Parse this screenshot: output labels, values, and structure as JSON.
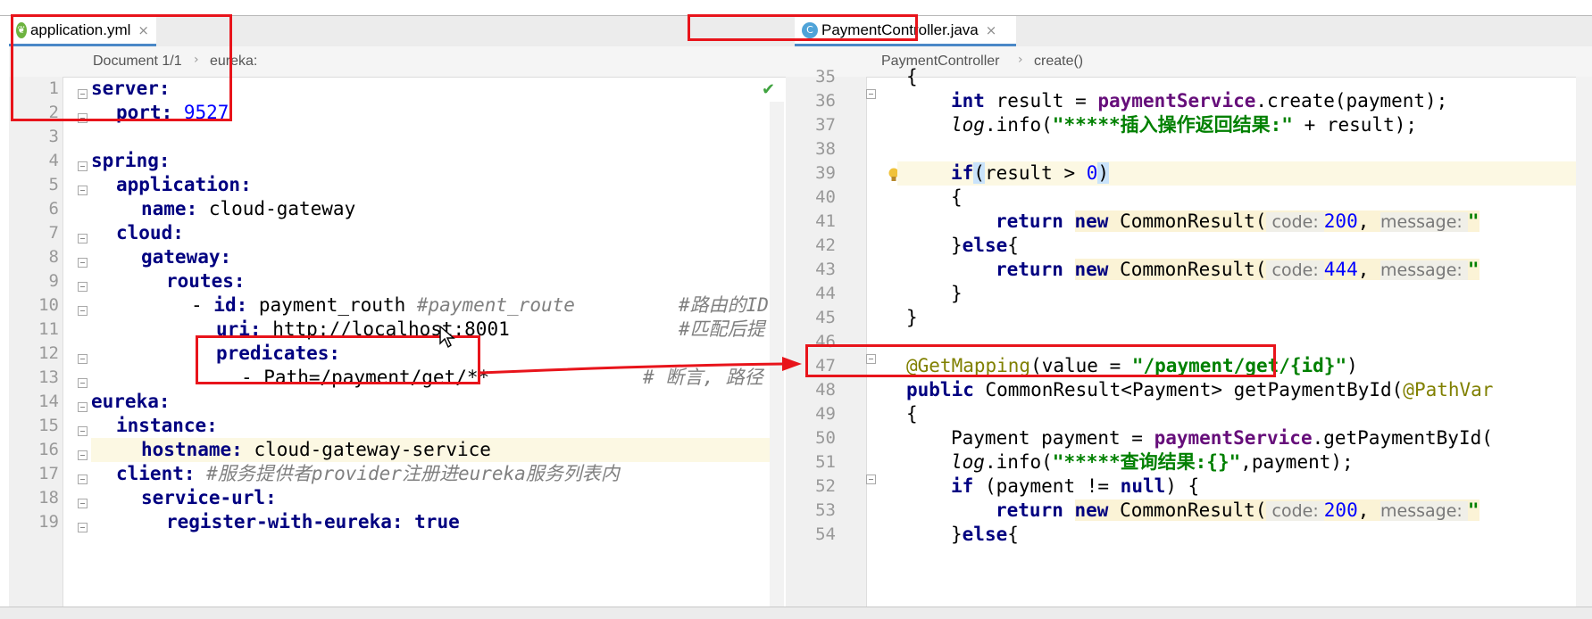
{
  "left_editor": {
    "tab": {
      "label": "application.yml",
      "close": "×"
    },
    "breadcrumb": [
      "Document 1/1",
      "eureka:"
    ],
    "crumb_sep": "›",
    "lines": [
      {
        "n": "1"
      },
      {
        "n": "2"
      },
      {
        "n": "3"
      },
      {
        "n": "4"
      },
      {
        "n": "5"
      },
      {
        "n": "6"
      },
      {
        "n": "7"
      },
      {
        "n": "8"
      },
      {
        "n": "9"
      },
      {
        "n": "10"
      },
      {
        "n": "11"
      },
      {
        "n": "12"
      },
      {
        "n": "13"
      },
      {
        "n": "14"
      },
      {
        "n": "15"
      },
      {
        "n": "16"
      },
      {
        "n": "17"
      },
      {
        "n": "18"
      },
      {
        "n": "19"
      }
    ],
    "code": {
      "l1_key": "server:",
      "l2_key": "port:",
      "l2_val": "9527",
      "l4_key": "spring:",
      "l5_key": "application:",
      "l6_key": "name:",
      "l6_val": " cloud-gateway",
      "l7_key": "cloud:",
      "l8_key": "gateway:",
      "l9_key": "routes:",
      "l10_dash": "- ",
      "l10_key": "id:",
      "l10_val": " payment_routh ",
      "l10_c1": "#payment_route",
      "l10_c2": "#路由的ID",
      "l11_key": "uri:",
      "l11_val": " http://localhost:8001",
      "l11_c": "#匹配后提",
      "l12_key": "predicates:",
      "l13_val": "- Path=/payment/get/**",
      "l13_c": "# 断言, 路径",
      "l14_key": "eureka:",
      "l15_key": "instance:",
      "l16_key": "hostname:",
      "l16_val": " cloud-gateway-service",
      "l17_key": "client:",
      "l17_c": " #服务提供者provider注册进eureka服务列表内",
      "l18_key": "service-url:",
      "l19_key": "register-with-eureka:",
      "l19_val": " true"
    }
  },
  "right_editor": {
    "tab": {
      "label": "PaymentController.java",
      "close": "×",
      "icon_letter": "C"
    },
    "breadcrumb": [
      "PaymentController",
      "create()"
    ],
    "crumb_sep": "›",
    "lines": [
      {
        "n": "35"
      },
      {
        "n": "36"
      },
      {
        "n": "37"
      },
      {
        "n": "38"
      },
      {
        "n": "39"
      },
      {
        "n": "40"
      },
      {
        "n": "41"
      },
      {
        "n": "42"
      },
      {
        "n": "43"
      },
      {
        "n": "44"
      },
      {
        "n": "45"
      },
      {
        "n": "46"
      },
      {
        "n": "47"
      },
      {
        "n": "48"
      },
      {
        "n": "49"
      },
      {
        "n": "50"
      },
      {
        "n": "51"
      },
      {
        "n": "52"
      },
      {
        "n": "53"
      },
      {
        "n": "54"
      }
    ],
    "code": {
      "l35": "{",
      "l36_kw": "int",
      "l36_a": " result = ",
      "l36_f": "paymentService",
      "l36_b": ".create(payment);",
      "l37_log": "log",
      "l37_a": ".info(",
      "l37_s": "\"*****插入操作返回结果:\"",
      "l37_b": " + result);",
      "l39_kw": "if",
      "l39_p1": "(",
      "l39_a": "result > ",
      "l39_n": "0",
      "l39_p2": ")",
      "l40": "{",
      "l41_kw": "return",
      "l41_new": "new",
      "l41_a": " CommonResult(",
      "l41_h1": " code: ",
      "l41_n": "200",
      "l41_b": ", ",
      "l41_h2": "message: ",
      "l41_q": "\"",
      "l42_a": "}",
      "l42_kw": "else",
      "l42_b": "{",
      "l43_kw": "return",
      "l43_new": "new",
      "l43_a": " CommonResult(",
      "l43_h1": " code: ",
      "l43_n": "444",
      "l43_b": ", ",
      "l43_h2": "message: ",
      "l43_q": "\"",
      "l44": "}",
      "l45": "}",
      "l47_an": "@GetMapping",
      "l47_a": "(value = ",
      "l47_s": "\"/payment/get/{id}\"",
      "l47_b": ")",
      "l48_kw": "public",
      "l48_a": " CommonResult<Payment> getPaymentById(",
      "l48_an": "@PathVar",
      "l49": "{",
      "l50_a": "Payment payment = ",
      "l50_f": "paymentService",
      "l50_b": ".getPaymentById(",
      "l51_log": "log",
      "l51_a": ".info(",
      "l51_s": "\"*****查询结果:{}\"",
      "l51_b": ",payment);",
      "l52_kw": "if",
      "l52_a": " (payment != ",
      "l52_kw2": "null",
      "l52_b": ") {",
      "l53_kw": "return",
      "l53_new": "new",
      "l53_a": " CommonResult(",
      "l53_h1": " code: ",
      "l53_n": "200",
      "l53_b": ", ",
      "l53_h2": "message: ",
      "l53_q": "\"",
      "l54_a": "}",
      "l54_kw": "else",
      "l54_b": "{"
    }
  },
  "colors": {
    "annotation_red": "#e8141b",
    "keyword": "#000080",
    "number": "#0000ff",
    "string": "#008000"
  }
}
